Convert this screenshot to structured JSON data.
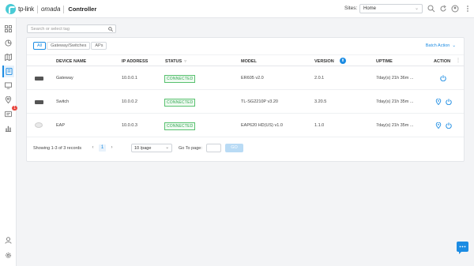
{
  "header": {
    "brand": "tp-link",
    "product": "omada",
    "title": "Controller",
    "sites_label": "Sites:",
    "site_selected": "Home"
  },
  "search": {
    "placeholder": "Search or select tag"
  },
  "tabs": [
    {
      "label": "All",
      "active": true
    },
    {
      "label": "Gateway/Switches",
      "active": false
    },
    {
      "label": "APs",
      "active": false
    }
  ],
  "batch_action": "Batch Action",
  "columns": {
    "device_name": "DEVICE NAME",
    "ip": "IP ADDRESS",
    "status": "STATUS",
    "model": "MODEL",
    "version": "VERSION",
    "uptime": "UPTIME",
    "action": "ACTION"
  },
  "devices": [
    {
      "type": "gateway",
      "name": "Gateway",
      "ip": "10.0.0.1",
      "status": "CONNECTED",
      "model": "ER605 v2.0",
      "version": "2.0.1",
      "uptime": "7day(s) 21h 36m ..."
    },
    {
      "type": "switch",
      "name": "Switch",
      "ip": "10.0.0.2",
      "status": "CONNECTED",
      "model": "TL-SG2210P v3.20",
      "version": "3.20.5",
      "uptime": "7day(s) 21h 35m ..."
    },
    {
      "type": "ap",
      "name": "EAP",
      "ip": "10.0.0.3",
      "status": "CONNECTED",
      "model": "EAP620 HD(US) v1.0",
      "version": "1.1.0",
      "uptime": "7day(s) 21h 35m ..."
    }
  ],
  "footer": {
    "records": "Showing 1-3 of 3 records",
    "page": "1",
    "per_page": "10 /page",
    "goto_label": "Go To page:",
    "go_button": "GO"
  },
  "notification_badge": "1",
  "colors": {
    "accent": "#1c8ce3",
    "connected": "#2fa64f"
  }
}
